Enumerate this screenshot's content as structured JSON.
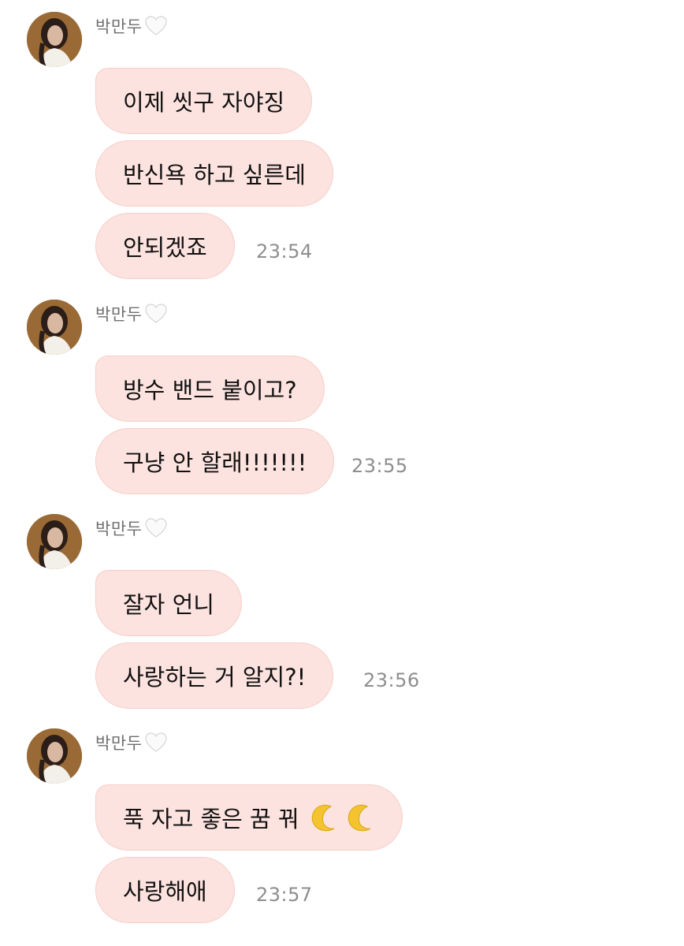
{
  "sender": {
    "name": "박만두"
  },
  "colors": {
    "bubble_fill": "#fce3df",
    "bubble_border": "#f5cfc9",
    "time_text": "#8e8e8e",
    "sender_text": "#6f6f6f"
  },
  "groups": [
    {
      "messages": [
        "이제 씻구 자야징",
        "반신욕 하고 싶른데",
        "안되겠죠"
      ],
      "time": "23:54"
    },
    {
      "messages": [
        "방수 밴드 붙이고?",
        "구냥 안 할래!!!!!!!"
      ],
      "time": "23:55"
    },
    {
      "messages": [
        "잘자 언니",
        "사랑하는 거 알지?!"
      ],
      "time": "23:56"
    },
    {
      "messages": [
        "푹 자고 좋은 꿈 꿔",
        "사랑해애"
      ],
      "time": "23:57",
      "emoji": [
        "crescent-moon-icon",
        "crescent-moon-icon"
      ]
    }
  ]
}
